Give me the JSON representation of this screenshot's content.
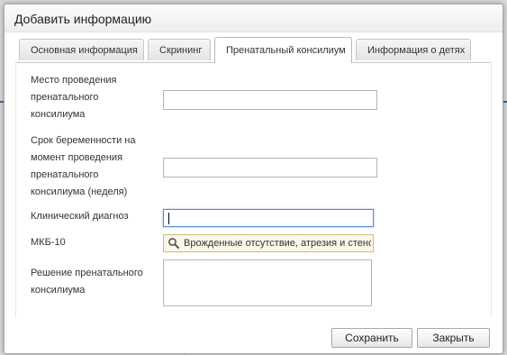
{
  "dialog": {
    "title": "Добавить информацию"
  },
  "tabs": [
    {
      "label": "Основная информация",
      "active": false
    },
    {
      "label": "Скрининг",
      "active": false
    },
    {
      "label": "Пренатальный консилиум",
      "active": true
    },
    {
      "label": "Информация о детях",
      "active": false
    }
  ],
  "form": {
    "place": {
      "label_lines": [
        "Место проведения",
        "пренатального",
        "консилиума"
      ],
      "value": ""
    },
    "term": {
      "label_lines": [
        "Срок беременности на",
        "момент проведения",
        "пренатального",
        "консилиума (неделя)"
      ],
      "value": ""
    },
    "diagnosis": {
      "label": "Клинический диагноз",
      "value": ""
    },
    "mkb": {
      "label": "МКБ-10",
      "value": "Врожденные отсутствие, атрезия и стеноз"
    },
    "decision": {
      "label_lines": [
        "Решение пренатального",
        "консилиума"
      ],
      "value": ""
    }
  },
  "buttons": {
    "save": "Сохранить",
    "close": "Закрыть"
  },
  "colors": {
    "accent_stripe": "#2d6aa8",
    "focus_border": "#5b8cc7",
    "combo_background": "#fbf7e6"
  },
  "icons": {
    "mkb_search": "search-icon"
  }
}
